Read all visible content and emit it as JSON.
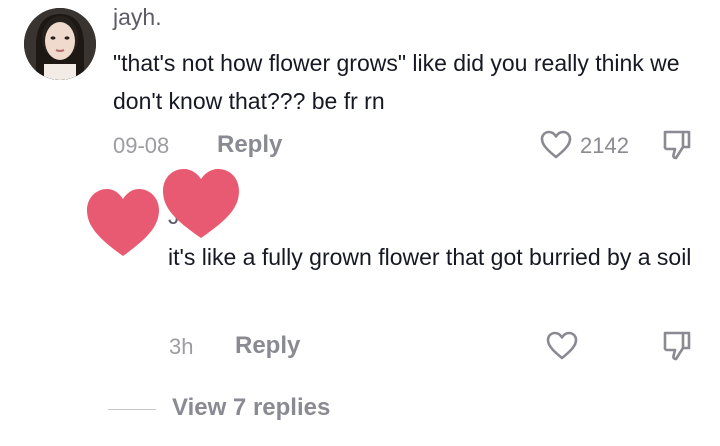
{
  "comment": {
    "username": "jayh.",
    "text": "\"that's not how flower grows\" like did you really think we don't know that??? be fr rn",
    "date": "09-08",
    "reply_label": "Reply",
    "like_count": "2142"
  },
  "reply": {
    "username_visible": "J",
    "text": "it's like a fully grown flower that got burried by a soil",
    "time": "3h",
    "reply_label": "Reply"
  },
  "thread": {
    "view_replies_label": "View 7 replies"
  },
  "icons": {
    "like": "heart-outline-icon",
    "dislike": "thumbs-down-icon",
    "sticker": "heart-sticker"
  },
  "colors": {
    "sticker_pink": "#e85a72",
    "muted_text": "#8a8a92"
  }
}
